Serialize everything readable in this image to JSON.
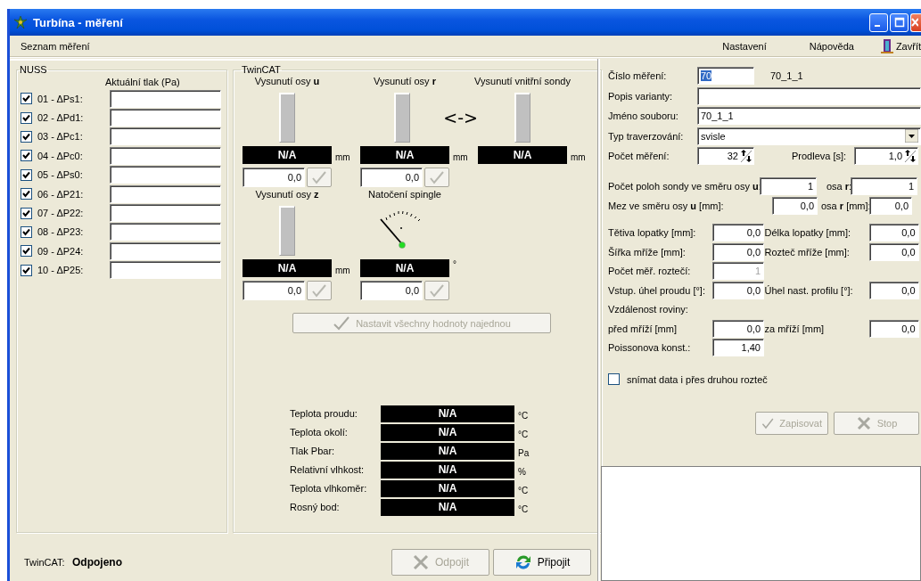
{
  "window": {
    "title": "Turbína - měření"
  },
  "menu": {
    "left": [
      {
        "label": "Seznam měření"
      }
    ],
    "right": [
      {
        "label": "Nastavení",
        "kind": "text"
      },
      {
        "label": "Nápověda",
        "kind": "text"
      },
      {
        "label": "Zavřít",
        "kind": "exit"
      }
    ]
  },
  "nuss": {
    "title": "NUSS",
    "column_heading": "Aktuální tlak (Pa)",
    "channels": [
      {
        "label": "01 - ΔPs1:",
        "checked": true
      },
      {
        "label": "02 - ΔPd1:",
        "checked": true
      },
      {
        "label": "03 - ΔPc1:",
        "checked": true
      },
      {
        "label": "04 - ΔPc0:",
        "checked": true
      },
      {
        "label": "05 - ΔPs0:",
        "checked": true
      },
      {
        "label": "06 - ΔP21:",
        "checked": true
      },
      {
        "label": "07 - ΔP22:",
        "checked": true
      },
      {
        "label": "08 - ΔP23:",
        "checked": true
      },
      {
        "label": "09 - ΔP24:",
        "checked": true
      },
      {
        "label": "10 - ΔP25:",
        "checked": true
      }
    ]
  },
  "twincat": {
    "title": "TwinCAT",
    "swap_sign": "<->",
    "axes": [
      {
        "kind": "bar",
        "label": "Vysunutí osy **u**",
        "reading": "N/A",
        "unit": "mm",
        "setpoint": "0,0"
      },
      {
        "kind": "bar",
        "label": "Vysunutí osy **r**",
        "reading": "N/A",
        "unit": "mm",
        "setpoint": "0,0"
      },
      {
        "kind": "bar",
        "label": "Vysunutí vnitřní sondy",
        "reading": "N/A",
        "unit": "mm"
      },
      {
        "kind": "bar",
        "label": "Vysunutí osy **z**",
        "reading": "N/A",
        "unit": "mm",
        "setpoint": "0,0"
      },
      {
        "kind": "dial",
        "label": "Natočení spingle",
        "reading": "N/A",
        "unit": "°",
        "setpoint": "0,0"
      }
    ],
    "set_all_button": {
      "label": "Nastavit všechny hodnoty najednou",
      "disabled": true
    },
    "sensors": [
      {
        "label": "Teplota proudu:",
        "reading": "N/A",
        "unit": "°C"
      },
      {
        "label": "Teplota okolí:",
        "reading": "N/A",
        "unit": "°C"
      },
      {
        "label": "Tlak Pbar:",
        "reading": "N/A",
        "unit": "Pa"
      },
      {
        "label": "Relativní vlhkost:",
        "reading": "N/A",
        "unit": "%"
      },
      {
        "label": "Teplota vlhkoměr:",
        "reading": "N/A",
        "unit": "°C"
      },
      {
        "label": "Rosný bod:",
        "reading": "N/A",
        "unit": "°C"
      }
    ]
  },
  "status": {
    "label": "TwinCAT:",
    "value": "Odpojeno",
    "buttons": [
      {
        "label": "Odpojit",
        "kind": "disconnect",
        "disabled": true
      },
      {
        "label": "Připojit",
        "kind": "connect",
        "disabled": false
      }
    ]
  },
  "measurement": {
    "number": {
      "label": "Číslo měření:",
      "value": "70",
      "text_selected": true,
      "caption": "70_1_1"
    },
    "variant": {
      "label": "Popis varianty:"
    },
    "file": {
      "label": "Jméno souboru:",
      "value": "70_1_1"
    },
    "traverse": {
      "label": "Typ traverzování:",
      "value": "svisle"
    },
    "count": {
      "label": "Počet měření:",
      "value": "32"
    },
    "delay": {
      "label": "Prodleva [s]:",
      "value": "1,0"
    },
    "positions": {
      "label": "Počet poloh sondy ve směru osy **u**:",
      "value": "1",
      "label_r": "osa **r**:",
      "value_r": "1"
    },
    "limit": {
      "label": "Mez ve směru osy **u** [mm]:",
      "value": "0,0",
      "label_r": "osa **r** [mm]:",
      "value_r": "0,0"
    },
    "params": [
      {
        "kind": "fields",
        "cells": [
          {
            "label": "Tětiva lopatky [mm]:",
            "value": "0,0",
            "disabled": false
          },
          {
            "label": "Délka lopatky [mm]:",
            "value": "0,0",
            "disabled": false
          }
        ]
      },
      {
        "kind": "fields",
        "cells": [
          {
            "label": "Šířka mříže [mm]:",
            "value": "0,0",
            "disabled": false
          },
          {
            "label": "Rozteč mříže [mm]:",
            "value": "0,0",
            "disabled": false
          }
        ]
      },
      {
        "kind": "fields",
        "cells": [
          {
            "label": "Počet měř. roztečí:",
            "value": "1",
            "disabled": true
          }
        ]
      },
      {
        "kind": "fields",
        "cells": [
          {
            "label": "Vstup. úhel proudu [°]:",
            "value": "0,0",
            "disabled": false
          },
          {
            "label": "Úhel nast. profilu [°]:",
            "value": "0,0",
            "disabled": false
          }
        ]
      },
      {
        "kind": "heading",
        "label": "Vzdálenost roviny:"
      },
      {
        "kind": "fields",
        "cells": [
          {
            "label": "před mříží [mm]",
            "value": "0,0",
            "disabled": false
          },
          {
            "label": "za mříží [mm]",
            "value": "0,0",
            "disabled": false
          }
        ]
      },
      {
        "kind": "fields",
        "cells": [
          {
            "label": "Poissonova konst.:",
            "value": "1,40",
            "disabled": false
          }
        ]
      }
    ],
    "second_pitch": {
      "label": "snímat data i přes druhou rozteč",
      "checked": false
    },
    "buttons": [
      {
        "label": "Zapisovat",
        "kind": "write",
        "disabled": true
      },
      {
        "label": "Stop",
        "kind": "stop",
        "disabled": true
      }
    ]
  }
}
